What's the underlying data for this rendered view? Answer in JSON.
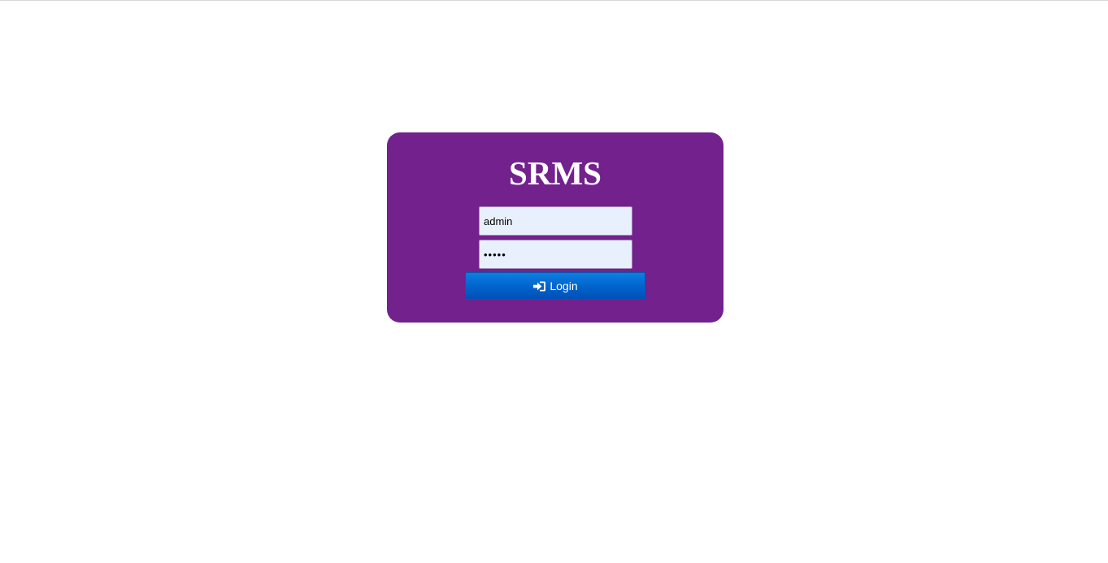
{
  "app": {
    "title": "SRMS"
  },
  "form": {
    "username_value": "admin",
    "password_value": "•••••",
    "login_label": "Login"
  },
  "icons": {
    "login": "sign-in-icon"
  },
  "colors": {
    "card_background": "#72218d",
    "button_background": "#0062cc",
    "input_background": "#e8f0fe"
  }
}
